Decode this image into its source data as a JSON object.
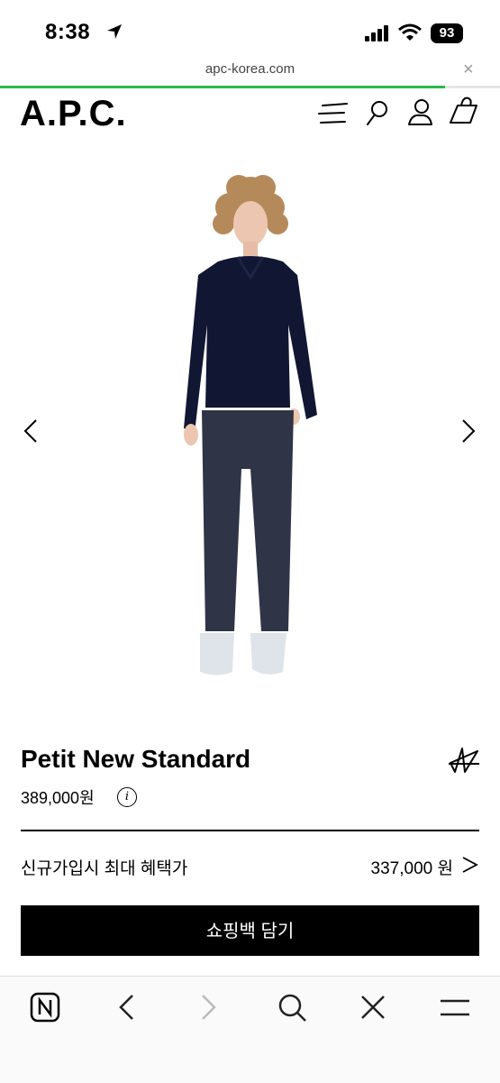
{
  "status_bar": {
    "time": "8:38",
    "battery": "93"
  },
  "browser": {
    "url": "apc-korea.com",
    "close_symbol": "×",
    "load_progress": 0.89
  },
  "header": {
    "logo": "A.P.C."
  },
  "product": {
    "name": "Petit New Standard",
    "price": "389,000원",
    "info_symbol": "i"
  },
  "promo": {
    "label": "신규가입시 최대 혜택가",
    "price": "337,000 원"
  },
  "cart_button": {
    "label": "쇼핑백 담기"
  },
  "colors": {
    "accent_progress": "#2db84d",
    "button_bg": "#000000",
    "sweater": "#111633",
    "jeans": "#2f3446"
  }
}
